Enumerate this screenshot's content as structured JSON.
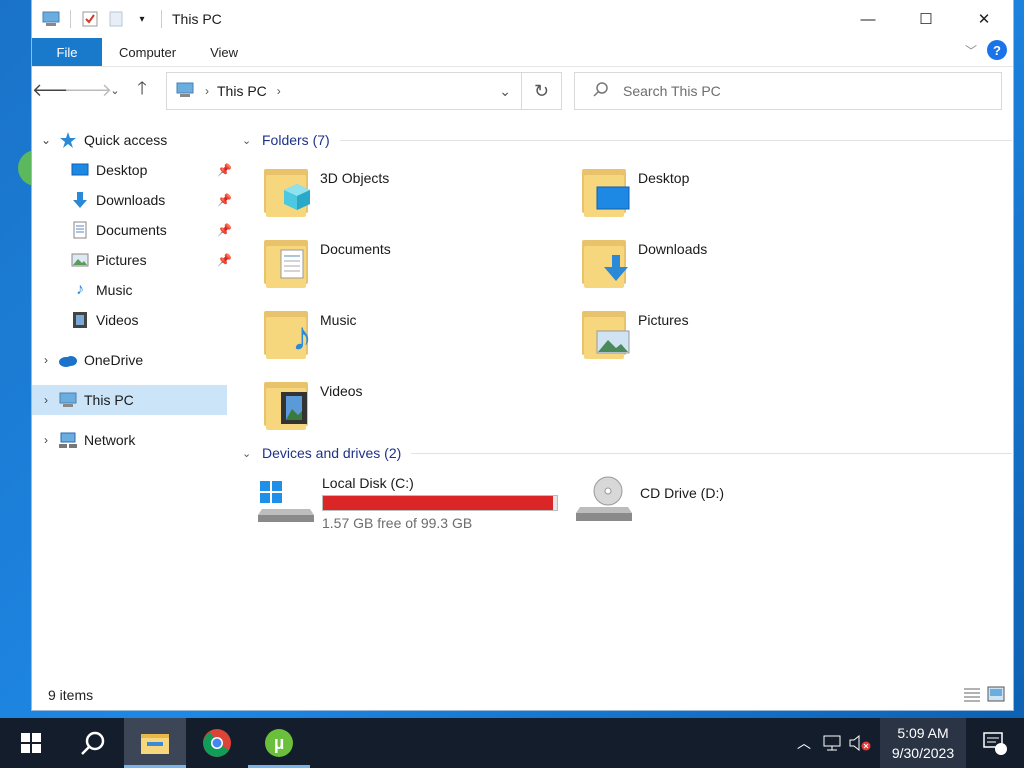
{
  "window": {
    "title": "This PC"
  },
  "ribbon": {
    "tabs": [
      "File",
      "Computer",
      "View"
    ]
  },
  "address": {
    "location": "This PC",
    "search_placeholder": "Search This PC"
  },
  "sidebar": {
    "quick_access": "Quick access",
    "quick_items": [
      "Desktop",
      "Downloads",
      "Documents",
      "Pictures",
      "Music",
      "Videos"
    ],
    "onedrive": "OneDrive",
    "this_pc": "This PC",
    "network": "Network"
  },
  "folders": {
    "header": "Folders (7)",
    "items": [
      "3D Objects",
      "Desktop",
      "Documents",
      "Downloads",
      "Music",
      "Pictures",
      "Videos"
    ]
  },
  "devices": {
    "header": "Devices and drives (2)",
    "local_disk": {
      "name": "Local Disk (C:)",
      "free_text": "1.57 GB free of 99.3 GB",
      "used_fraction": 0.984
    },
    "cd_drive": {
      "name": "CD Drive (D:)"
    }
  },
  "status": {
    "items": "9 items"
  },
  "taskbar": {
    "time": "5:09 AM",
    "date": "9/30/2023",
    "notifications": "1"
  },
  "colors": {
    "accent": "#1979ca",
    "selected": "#cce4f7",
    "disk_bar": "#da2626",
    "taskbar": "#141d2b"
  }
}
